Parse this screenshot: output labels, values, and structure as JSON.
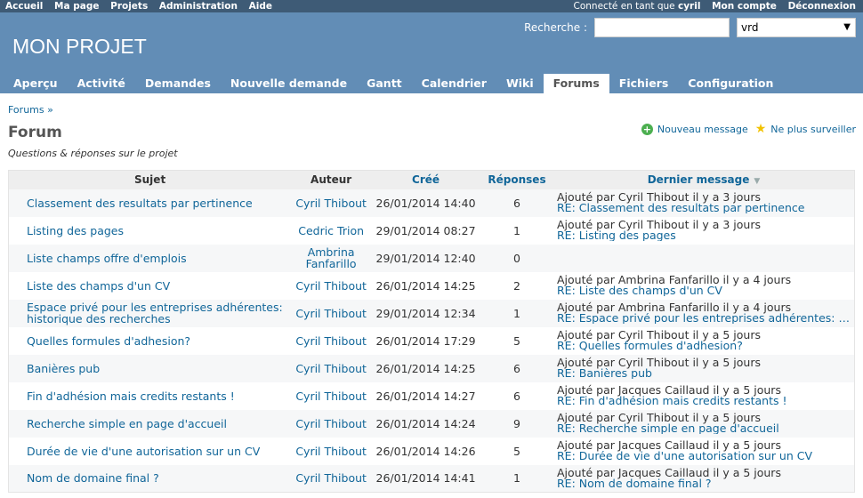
{
  "top_menu": {
    "items": [
      "Accueil",
      "Ma page",
      "Projets",
      "Administration",
      "Aide"
    ],
    "logged_as_prefix": "Connecté en tant que",
    "user": "cyril",
    "account": "Mon compte",
    "logout": "Déconnexion"
  },
  "header": {
    "title": "MON PROJET",
    "search_label": "Recherche :",
    "search_value": "",
    "project_select": "vrd"
  },
  "main_menu": {
    "tabs": [
      "Aperçu",
      "Activité",
      "Demandes",
      "Nouvelle demande",
      "Gantt",
      "Calendrier",
      "Wiki",
      "Forums",
      "Fichiers",
      "Configuration"
    ],
    "selected": "Forums"
  },
  "breadcrumb": "Forums »",
  "page_title": "Forum",
  "subtitle": "Questions & réponses sur le projet",
  "contextual": {
    "new_message": "Nouveau message",
    "unwatch": "Ne plus surveiller"
  },
  "table": {
    "headers": {
      "subject": "Sujet",
      "author": "Auteur",
      "created": "Créé",
      "replies": "Réponses",
      "last": "Dernier message"
    },
    "rows": [
      {
        "subject": "Classement des resultats par pertinence",
        "author": "Cyril Thibout",
        "created": "26/01/2014 14:40",
        "replies": "6",
        "last_author": "Ajouté par Cyril Thibout il y a 3 jours",
        "last_subject": "RE: Classement des resultats par pertinence"
      },
      {
        "subject": "Listing des pages",
        "author": "Cedric Trion",
        "created": "29/01/2014 08:27",
        "replies": "1",
        "last_author": "Ajouté par Cyril Thibout il y a 3 jours",
        "last_subject": "RE: Listing des pages"
      },
      {
        "subject": "Liste champs offre d'emplois",
        "author": "Ambrina Fanfarillo",
        "created": "29/01/2014 12:40",
        "replies": "0",
        "last_author": "",
        "last_subject": ""
      },
      {
        "subject": "Liste des champs d'un CV",
        "author": "Cyril Thibout",
        "created": "26/01/2014 14:25",
        "replies": "2",
        "last_author": "Ajouté par Ambrina Fanfarillo il y a 4 jours",
        "last_subject": "RE: Liste des champs d'un CV"
      },
      {
        "subject": "Espace privé pour les entreprises adhérentes: historique des recherches",
        "author": "Cyril Thibout",
        "created": "29/01/2014 12:34",
        "replies": "1",
        "last_author": "Ajouté par Ambrina Fanfarillo il y a 4 jours",
        "last_subject": "RE: Espace privé pour les entreprises adhérentes: histori..."
      },
      {
        "subject": "Quelles formules d'adhesion?",
        "author": "Cyril Thibout",
        "created": "26/01/2014 17:29",
        "replies": "5",
        "last_author": "Ajouté par Cyril Thibout il y a 5 jours",
        "last_subject": "RE: Quelles formules d'adhesion?"
      },
      {
        "subject": "Banières pub",
        "author": "Cyril Thibout",
        "created": "26/01/2014 14:25",
        "replies": "6",
        "last_author": "Ajouté par Cyril Thibout il y a 5 jours",
        "last_subject": "RE: Banières pub"
      },
      {
        "subject": "Fin d'adhésion mais credits restants !",
        "author": "Cyril Thibout",
        "created": "26/01/2014 14:27",
        "replies": "6",
        "last_author": "Ajouté par Jacques Caillaud il y a 5 jours",
        "last_subject": "RE: Fin d'adhésion mais credits restants !"
      },
      {
        "subject": "Recherche simple en page d'accueil",
        "author": "Cyril Thibout",
        "created": "26/01/2014 14:24",
        "replies": "9",
        "last_author": "Ajouté par Cyril Thibout il y a 5 jours",
        "last_subject": "RE: Recherche simple en page d'accueil"
      },
      {
        "subject": "Durée de vie d'une autorisation sur un CV",
        "author": "Cyril Thibout",
        "created": "26/01/2014 14:26",
        "replies": "5",
        "last_author": "Ajouté par Jacques Caillaud il y a 5 jours",
        "last_subject": "RE: Durée de vie d'une autorisation sur un CV"
      },
      {
        "subject": "Nom de domaine final ?",
        "author": "Cyril Thibout",
        "created": "26/01/2014 14:41",
        "replies": "1",
        "last_author": "Ajouté par Jacques Caillaud il y a 5 jours",
        "last_subject": "RE: Nom de domaine final ?"
      }
    ]
  }
}
